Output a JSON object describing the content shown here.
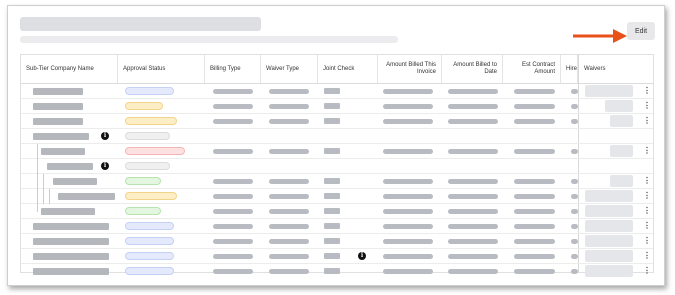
{
  "header": {
    "edit_label": "Edit"
  },
  "colors": {
    "arrow": "#e8511a",
    "pending_pill": "#fdeec5",
    "rejected_pill": "#fde0e0",
    "approved_pill": "#e3f6df",
    "submitted_pill": "#e4eafc",
    "draft_pill": "#f0f0f0"
  },
  "table": {
    "columns": [
      "Sub-Tier Company Name",
      "Approval Status",
      "Billing Type",
      "Waiver Type",
      "Joint Check",
      "Amount Billed This Invoice",
      "Amount Billed to Date",
      "Est Contract Amount",
      "Hire",
      "Waivers"
    ],
    "row_menu_icon": "more-vertical-icon",
    "info_icon": "info-icon"
  }
}
